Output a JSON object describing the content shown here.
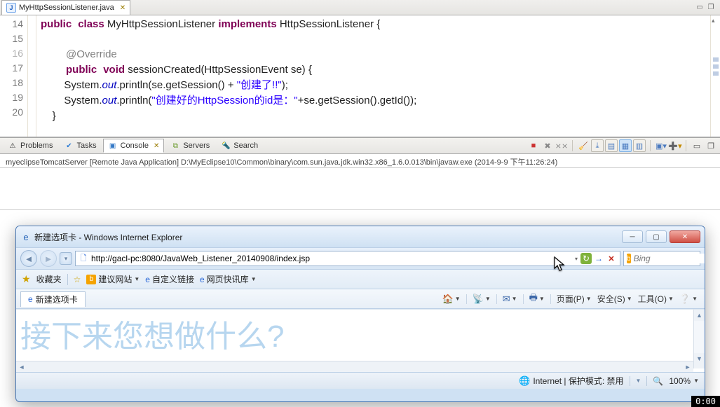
{
  "editor": {
    "tab_title": "MyHttpSessionListener.java",
    "lines": [
      "14",
      "15",
      "16",
      "17",
      "18",
      "19",
      "20"
    ]
  },
  "code": {
    "l14": {
      "a": "public",
      "b": "class",
      "c": " MyHttpSessionListener ",
      "d": "implements",
      "e": " HttpSessionListener {"
    },
    "l16": {
      "ann": "@Override"
    },
    "l17": {
      "a": "public",
      "b": "void",
      "c": " sessionCreated(HttpSessionEvent se) {"
    },
    "l18a": "        System.",
    "l18b": "out",
    "l18c": ".println(se.getSession() + ",
    "l18d": "\"创建了!!\"",
    "l18e": ");",
    "l19a": "        System.",
    "l19b": "out",
    "l19c": ".println(",
    "l19d": "\"创建好的HttpSession的id是：\"",
    "l19e": "+se.getSession().getId());",
    "l20": "    }"
  },
  "views": {
    "problems": "Problems",
    "tasks": "Tasks",
    "console": "Console",
    "servers": "Servers",
    "search": "Search"
  },
  "console": {
    "line": "myeclipseTomcatServer [Remote Java Application] D:\\MyEclipse10\\Common\\binary\\com.sun.java.jdk.win32.x86_1.6.0.013\\bin\\javaw.exe (2014-9-9 下午11:26:24)"
  },
  "ie": {
    "title": "新建选项卡 - Windows Internet Explorer",
    "url": "http://gacl-pc:8080/JavaWeb_Listener_20140908/index.jsp",
    "bing_placeholder": "Bing",
    "fav_label": "收藏夹",
    "fav_item1": "建议网站",
    "fav_item2": "自定义链接",
    "fav_item3": "网页快讯库",
    "tab_label": "新建选项卡",
    "cmd_page": "页面(P)",
    "cmd_safety": "安全(S)",
    "cmd_tools": "工具(O)",
    "content_big": "接下来您想做什么?",
    "status_zone": "Internet | 保护模式: 禁用",
    "zoom": "100%"
  },
  "timer": "0:00"
}
